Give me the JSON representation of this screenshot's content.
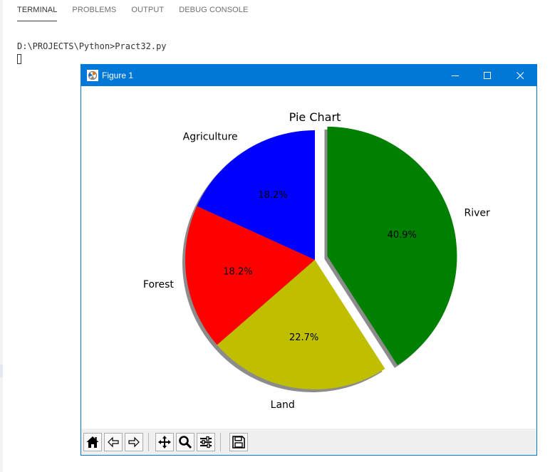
{
  "panel": {
    "tabs": [
      "TERMINAL",
      "PROBLEMS",
      "OUTPUT",
      "DEBUG CONSOLE"
    ],
    "active_tab": "TERMINAL"
  },
  "terminal": {
    "line": "D:\\PROJECTS\\Python>Pract32.py"
  },
  "window": {
    "title": "Figure 1",
    "title_bar_color": "#0078d7"
  },
  "chart_data": {
    "type": "pie",
    "title": "Pie Chart",
    "labels": [
      "Agriculture",
      "Forest",
      "Land",
      "River"
    ],
    "values": [
      18.2,
      18.2,
      22.7,
      40.9
    ],
    "autopct": [
      "18.2%",
      "18.2%",
      "22.7%",
      "40.9%"
    ],
    "colors": [
      "#0000ff",
      "#ff0000",
      "#bfbf00",
      "#008000"
    ],
    "explode": [
      0,
      0,
      0,
      0.1
    ],
    "shadow": true,
    "startangle": 90
  },
  "toolbar": {
    "buttons": [
      "home-icon",
      "back-icon",
      "forward-icon",
      "pan-icon",
      "zoom-icon",
      "configure-subplots-icon",
      "save-icon"
    ]
  }
}
